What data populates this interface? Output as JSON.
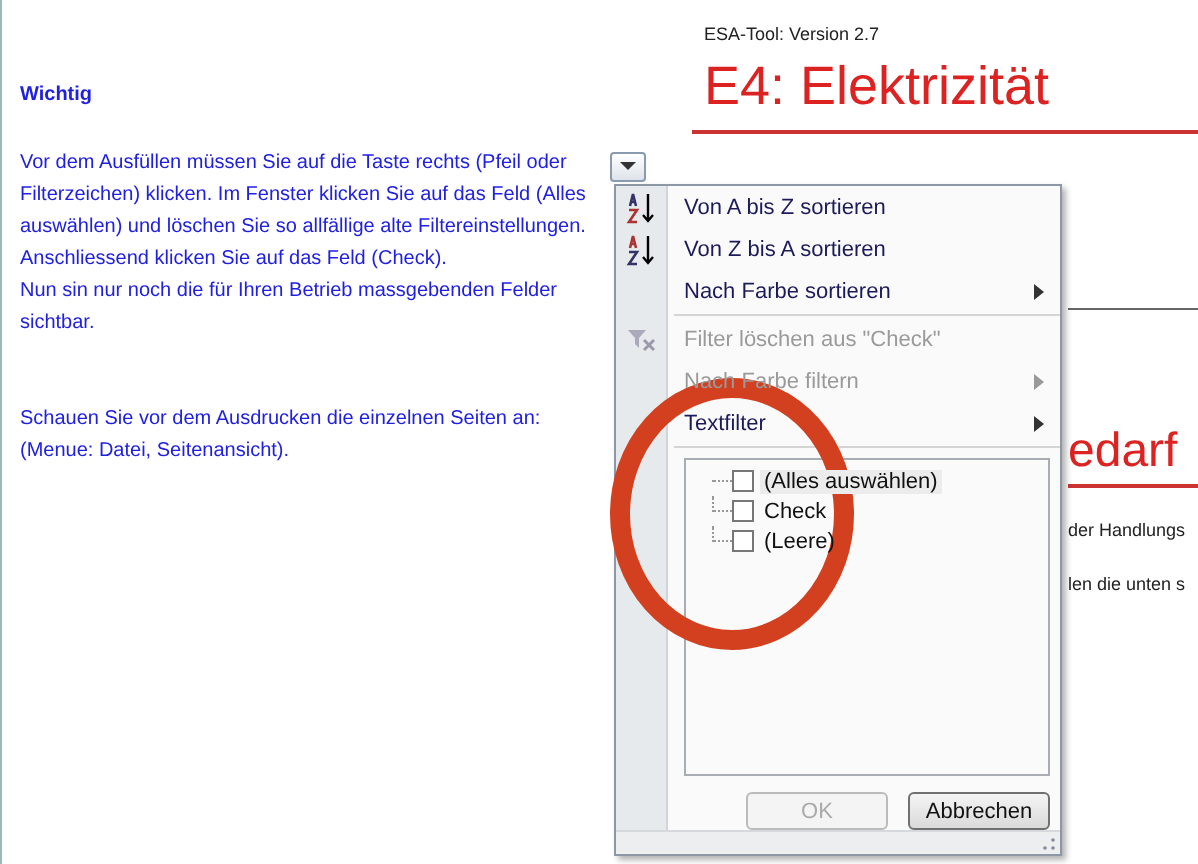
{
  "instructions": {
    "heading": "Wichtig",
    "paragraphs": [
      "Vor dem Ausfüllen müssen Sie auf die Taste rechts (Pfeil oder Filterzeichen) klicken. Im Fenster klicken Sie auf das Feld (Alles auswählen) und löschen Sie so allfällige alte Filtereinstellungen. Anschliessend klicken Sie auf das Feld (Check).",
      "Nun sin nur noch die für Ihren Betrieb massgebenden Felder sichtbar.",
      "Schauen Sie vor dem Ausdrucken die einzelnen Seiten an: (Menue: Datei, Seitenansicht)."
    ]
  },
  "sheet": {
    "version": "ESA-Tool: Version 2.7",
    "title": "E4: Elektrizität",
    "section_heading": "edarf",
    "lines": [
      "der Handlungs",
      "len die unten s"
    ]
  },
  "filter_menu": {
    "items": [
      {
        "kind": "sort-az",
        "label": "Von A bis Z sortieren",
        "disabled": false,
        "submenu": false
      },
      {
        "kind": "sort-za",
        "label": "Von Z bis A sortieren",
        "disabled": false,
        "submenu": false
      },
      {
        "kind": "plain",
        "label": "Nach Farbe sortieren",
        "disabled": false,
        "submenu": true
      },
      {
        "kind": "separator"
      },
      {
        "kind": "clear-filter",
        "label": "Filter löschen aus \"Check\"",
        "disabled": true,
        "submenu": false
      },
      {
        "kind": "plain",
        "label": "Nach Farbe filtern",
        "disabled": true,
        "submenu": true
      },
      {
        "kind": "plain",
        "label": "Textfilter",
        "disabled": false,
        "submenu": true
      },
      {
        "kind": "separator"
      }
    ],
    "values": [
      {
        "label": "(Alles auswählen)",
        "checked": false,
        "selected": true
      },
      {
        "label": "Check",
        "checked": false,
        "selected": false
      },
      {
        "label": "(Leere)",
        "checked": false,
        "selected": false
      }
    ],
    "buttons": [
      {
        "label": "OK",
        "disabled": true
      },
      {
        "label": "Abbrechen",
        "disabled": false
      }
    ]
  },
  "annotation": {
    "kind": "circle"
  }
}
